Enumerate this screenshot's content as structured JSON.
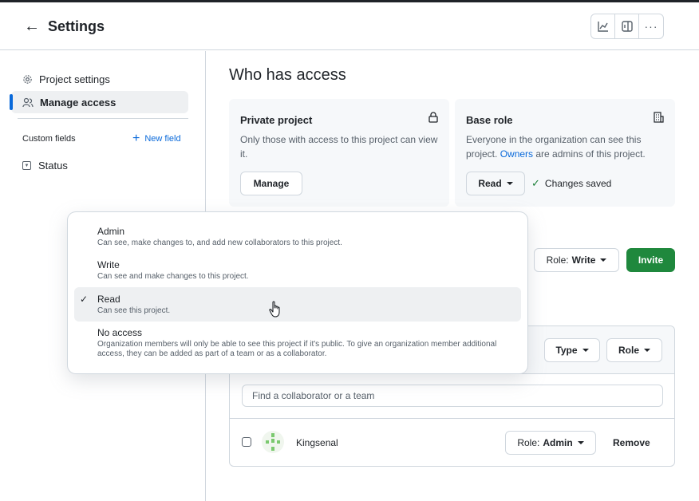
{
  "header": {
    "back_label": "Settings",
    "toolbar_icons": [
      "chart-icon",
      "panel-icon",
      "more-icon"
    ]
  },
  "sidebar": {
    "items": [
      {
        "label": "Project settings",
        "icon": "gear-icon",
        "active": false
      },
      {
        "label": "Manage access",
        "icon": "people-icon",
        "active": true
      }
    ],
    "custom_fields_label": "Custom fields",
    "new_field_label": "New field",
    "fields": [
      {
        "label": "Status",
        "icon": "single-select-icon"
      }
    ]
  },
  "main": {
    "title": "Who has access",
    "private_card": {
      "title": "Private project",
      "description": "Only those with access to this project can view it.",
      "button": "Manage",
      "icon": "lock-icon"
    },
    "base_role_card": {
      "title": "Base role",
      "description_pre": "Everyone in the organization can see this project. ",
      "description_link": "Owners",
      "description_post": " are admins of this project.",
      "role_button": "Read",
      "saved_text": "Changes saved",
      "icon": "building-icon"
    },
    "invite": {
      "role_prefix": "Role:",
      "role_value": "Write",
      "invite_label": "Invite"
    },
    "collaborators": {
      "type_filter": "Type",
      "role_filter": "Role",
      "search_placeholder": "Find a collaborator or a team",
      "rows": [
        {
          "name": "Kingsenal",
          "role_prefix": "Role:",
          "role_value": "Admin",
          "remove_label": "Remove"
        }
      ]
    }
  },
  "role_menu": {
    "selected": "Read",
    "options": [
      {
        "label": "Admin",
        "desc": "Can see, make changes to, and add new collaborators to this project."
      },
      {
        "label": "Write",
        "desc": "Can see and make changes to this project."
      },
      {
        "label": "Read",
        "desc": "Can see this project."
      },
      {
        "label": "No access",
        "desc": "Organization members will only be able to see this project if it's public. To give an organization member additional access, they can be added as part of a team or as a collaborator."
      }
    ]
  },
  "colors": {
    "accent": "#0969da",
    "success": "#1f883d",
    "border": "#d0d7de"
  }
}
